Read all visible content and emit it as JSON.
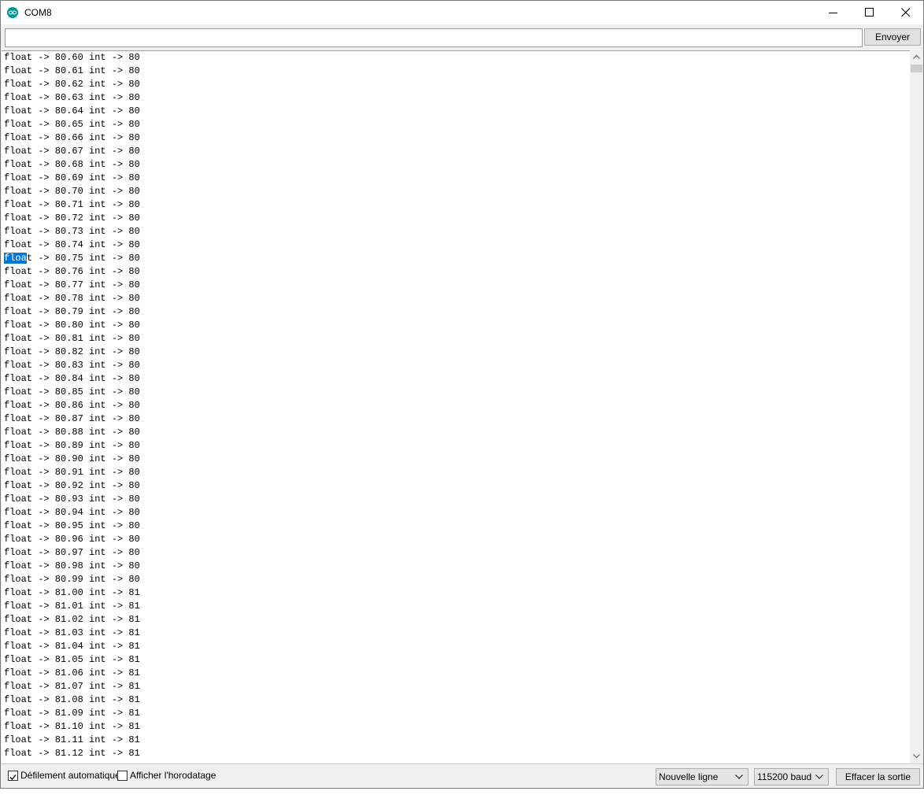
{
  "window": {
    "title": "COM8",
    "icon_name": "arduino-icon",
    "accent_color": "#00979c"
  },
  "send_bar": {
    "input_value": "",
    "send_label": "Envoyer"
  },
  "output": {
    "selection_color": "#0078d7",
    "lines": [
      "float -> 80.60 int -> 80",
      "float -> 80.61 int -> 80",
      "float -> 80.62 int -> 80",
      "float -> 80.63 int -> 80",
      "float -> 80.64 int -> 80",
      "float -> 80.65 int -> 80",
      "float -> 80.66 int -> 80",
      "float -> 80.67 int -> 80",
      "float -> 80.68 int -> 80",
      "float -> 80.69 int -> 80",
      "float -> 80.70 int -> 80",
      "float -> 80.71 int -> 80",
      "float -> 80.72 int -> 80",
      "float -> 80.73 int -> 80",
      "float -> 80.74 int -> 80",
      "float -> 80.75 int -> 80",
      "float -> 80.76 int -> 80",
      "float -> 80.77 int -> 80",
      "float -> 80.78 int -> 80",
      "float -> 80.79 int -> 80",
      "float -> 80.80 int -> 80",
      "float -> 80.81 int -> 80",
      "float -> 80.82 int -> 80",
      "float -> 80.83 int -> 80",
      "float -> 80.84 int -> 80",
      "float -> 80.85 int -> 80",
      "float -> 80.86 int -> 80",
      "float -> 80.87 int -> 80",
      "float -> 80.88 int -> 80",
      "float -> 80.89 int -> 80",
      "float -> 80.90 int -> 80",
      "float -> 80.91 int -> 80",
      "float -> 80.92 int -> 80",
      "float -> 80.93 int -> 80",
      "float -> 80.94 int -> 80",
      "float -> 80.95 int -> 80",
      "float -> 80.96 int -> 80",
      "float -> 80.97 int -> 80",
      "float -> 80.98 int -> 80",
      "float -> 80.99 int -> 80",
      "float -> 81.00 int -> 81",
      "float -> 81.01 int -> 81",
      "float -> 81.02 int -> 81",
      "float -> 81.03 int -> 81",
      "float -> 81.04 int -> 81",
      "float -> 81.05 int -> 81",
      "float -> 81.06 int -> 81",
      "float -> 81.07 int -> 81",
      "float -> 81.08 int -> 81",
      "float -> 81.09 int -> 81",
      "float -> 81.10 int -> 81",
      "float -> 81.11 int -> 81",
      "float -> 81.12 int -> 81"
    ],
    "selected_line_index": 15,
    "selected_text": "floa"
  },
  "status_bar": {
    "autoscroll_label": "Défilement automatique",
    "autoscroll_checked": true,
    "timestamp_label": "Afficher l'horodatage",
    "timestamp_checked": false,
    "line_ending": "Nouvelle ligne",
    "baud_rate": "115200 baud",
    "clear_label": "Effacer la sortie"
  }
}
